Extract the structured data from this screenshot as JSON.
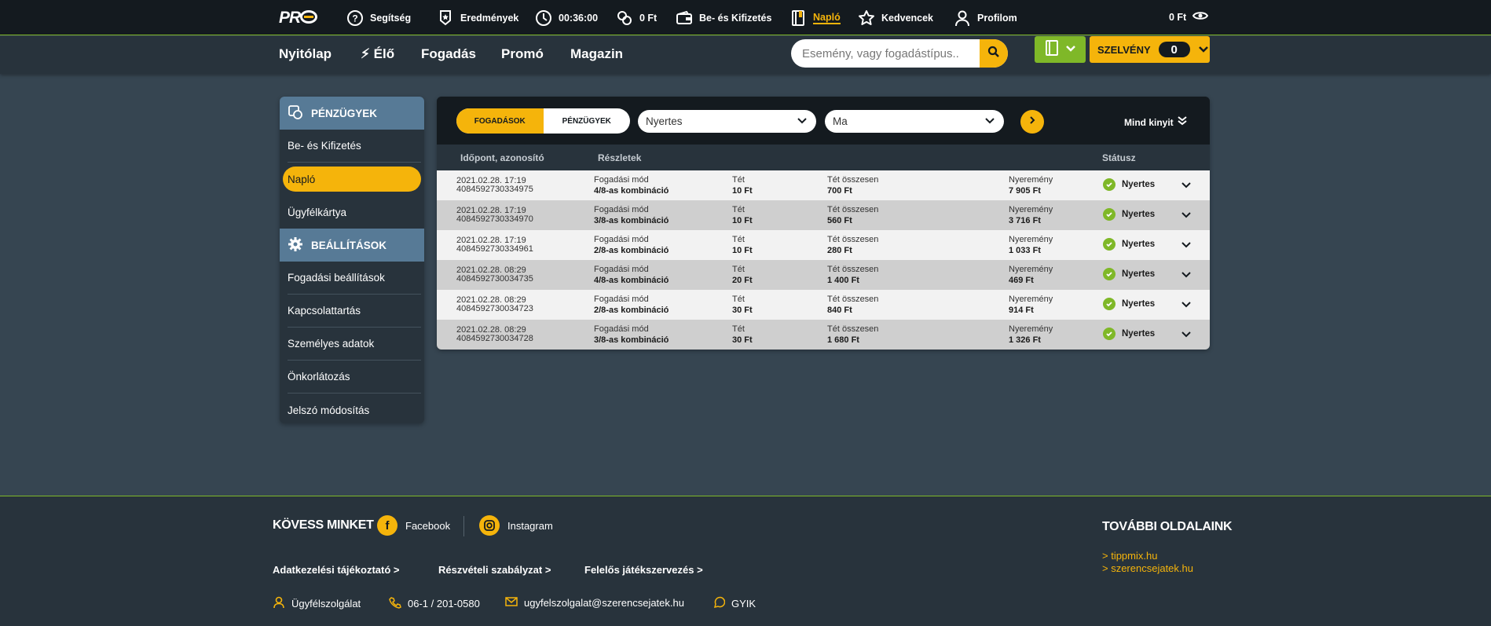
{
  "brand": {
    "logo_text": "PRO"
  },
  "topbar": {
    "help": "Segítség",
    "results": "Eredmények",
    "timer": "00:36:00",
    "bonus": "0 Ft",
    "payments": "Be- és Kifizetés",
    "log": "Napló",
    "favorites": "Kedvencek",
    "profile": "Profilom",
    "balance": "0 Ft"
  },
  "nav": {
    "items": [
      "Nyitólap",
      "Élő",
      "Fogadás",
      "Promó",
      "Magazin"
    ],
    "search_placeholder": "Esemény, vagy fogadástípus...",
    "slip_label": "SZELVÉNY",
    "slip_count": "0"
  },
  "sidebar": {
    "finance_header": "PÉNZÜGYEK",
    "finance_items": [
      "Be- és Kifizetés",
      "Napló",
      "Ügyfélkártya"
    ],
    "settings_header": "BEÁLLÍTÁSOK",
    "settings_items": [
      "Fogadási beállítások",
      "Kapcsolattartás",
      "Személyes adatok",
      "Önkorlátozás",
      "Jelszó módosítás"
    ]
  },
  "filters": {
    "tab_bets": "FOGADÁSOK",
    "tab_finance": "PÉNZÜGYEK",
    "status_value": "Nyertes",
    "period_value": "Ma",
    "expand_all": "Mind kinyit"
  },
  "table": {
    "headers": {
      "time_id": "Időpont, azonosító",
      "details": "Részletek",
      "status": "Státusz"
    },
    "labels": {
      "mode": "Fogadási mód",
      "stake": "Tét",
      "total": "Tét összesen",
      "win": "Nyeremény"
    },
    "rows": [
      {
        "date": "2021.02.28. 17:19",
        "id": "4084592730334975",
        "mode": "4/8-as kombináció",
        "stake": "10 Ft",
        "total": "700 Ft",
        "win": "7 905 Ft",
        "status": "Nyertes"
      },
      {
        "date": "2021.02.28. 17:19",
        "id": "4084592730334970",
        "mode": "3/8-as kombináció",
        "stake": "10 Ft",
        "total": "560 Ft",
        "win": "3 716 Ft",
        "status": "Nyertes"
      },
      {
        "date": "2021.02.28. 17:19",
        "id": "4084592730334961",
        "mode": "2/8-as kombináció",
        "stake": "10 Ft",
        "total": "280 Ft",
        "win": "1 033 Ft",
        "status": "Nyertes"
      },
      {
        "date": "2021.02.28. 08:29",
        "id": "4084592730034735",
        "mode": "4/8-as kombináció",
        "stake": "20 Ft",
        "total": "1 400 Ft",
        "win": "469 Ft",
        "status": "Nyertes"
      },
      {
        "date": "2021.02.28. 08:29",
        "id": "4084592730034723",
        "mode": "2/8-as kombináció",
        "stake": "30 Ft",
        "total": "840 Ft",
        "win": "914 Ft",
        "status": "Nyertes"
      },
      {
        "date": "2021.02.28. 08:29",
        "id": "4084592730034728",
        "mode": "3/8-as kombináció",
        "stake": "30 Ft",
        "total": "1 680 Ft",
        "win": "1 326 Ft",
        "status": "Nyertes"
      }
    ]
  },
  "footer": {
    "follow_title": "KÖVESS MINKET",
    "facebook": "Facebook",
    "instagram": "Instagram",
    "links": [
      "Adatkezelési tájékoztató >",
      "Részvételi szabályzat >",
      "Felelős játékszervezés >"
    ],
    "customer_service": "Ügyfélszolgálat",
    "phone": "06-1 / 201-0580",
    "email": "ugyfelszolgalat@szerencsejatek.hu",
    "faq": "GYIK",
    "other_title": "TOVÁBBI OLDALAINK",
    "other_sites": [
      ">  tippmix.hu",
      ">  szerencsejatek.hu"
    ]
  },
  "colors": {
    "accent": "#f5b40b",
    "green": "#7fb828",
    "dark": "#141a1f",
    "panel": "#28333c",
    "background": "#364551",
    "sidebar_header": "#577a96"
  }
}
